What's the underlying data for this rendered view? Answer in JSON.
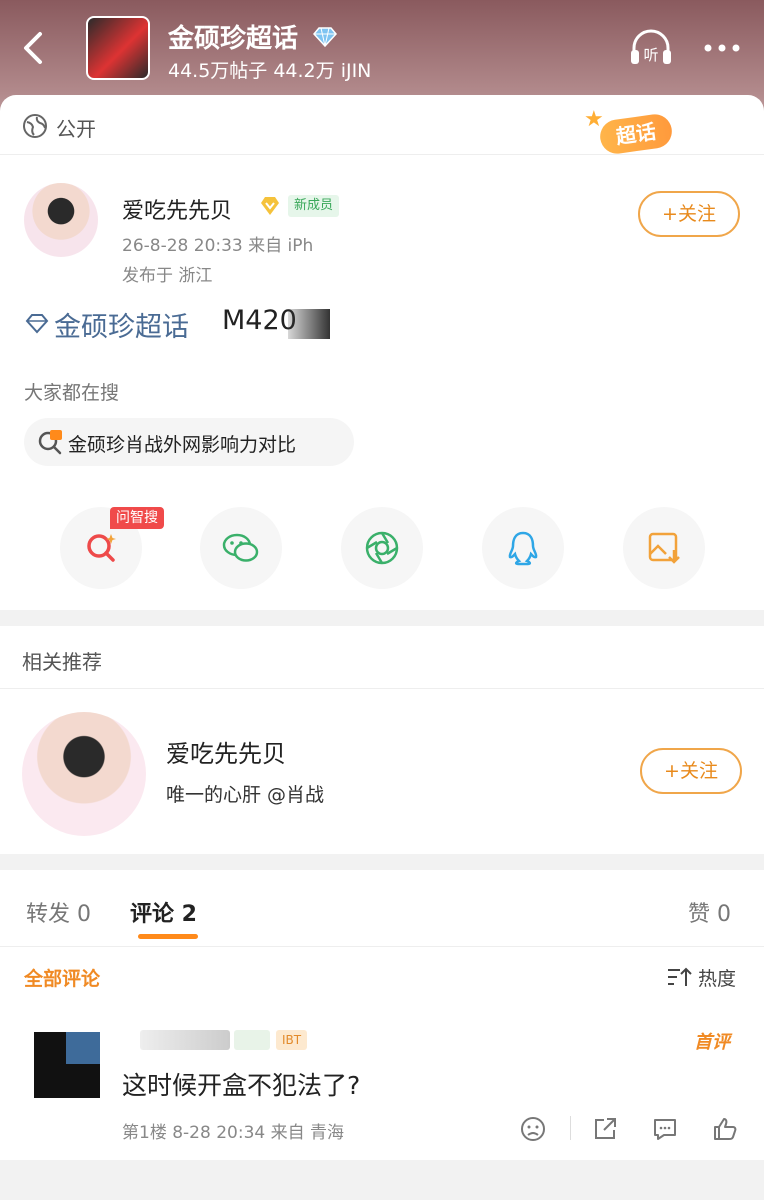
{
  "header": {
    "title": "金硕珍超话",
    "stats": "44.5万帖子 44.2万 iJIN"
  },
  "post": {
    "visibility": "公开",
    "badge": "超话",
    "author": {
      "name": "爱吃先先贝",
      "new_badge": "新成员",
      "time": "26-8-28 20:33 来自 iPh",
      "location": "发布于 浙江"
    },
    "follow_label": "+关注",
    "topic": "金硕珍超话",
    "topic_suffix": "M420",
    "search_label": "大家都在搜",
    "search_item": "金硕珍肖战外网影响力对比",
    "ai_badge": "问智搜"
  },
  "related": {
    "title": "相关推荐",
    "name": "爱吃先先贝",
    "desc": "唯一的心肝 @肖战",
    "follow_label": "+关注"
  },
  "tabs": {
    "repost": "转发 0",
    "comment": "评论 2",
    "like": "赞 0"
  },
  "comments": {
    "all_label": "全部评论",
    "sort_label": "热度",
    "first_badge": "首评",
    "tag": "IBT",
    "text": "这时候开盒不犯法了?",
    "meta": "第1楼 8-28 20:34 来自 青海"
  },
  "colors": {
    "accent": "#f08a24",
    "link": "#4a6b94"
  }
}
